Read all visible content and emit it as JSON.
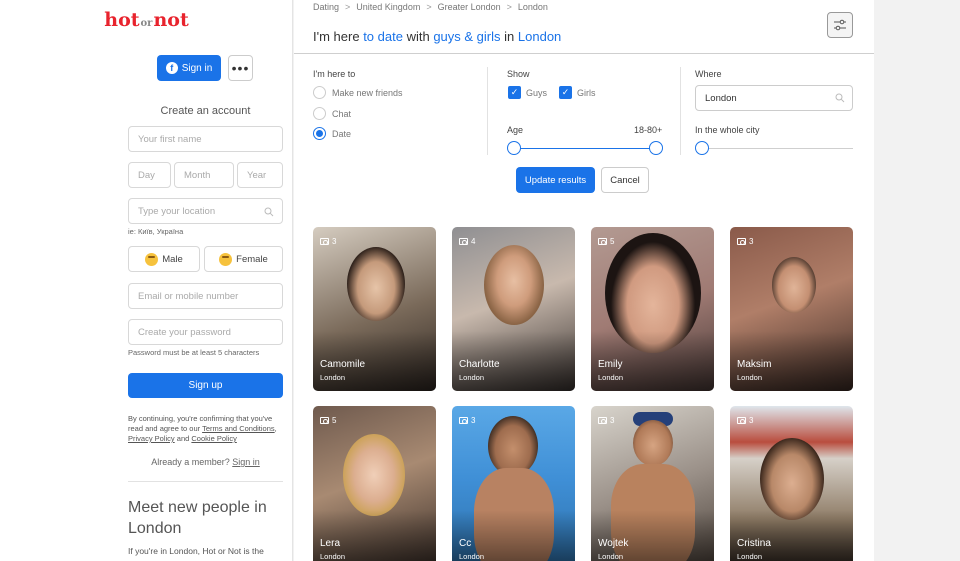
{
  "sidebar": {
    "logo": {
      "part1": "hot",
      "part2": "or",
      "part3": "not"
    },
    "signin_label": "Sign in",
    "create_title": "Create an account",
    "first_name_placeholder": "Your first name",
    "day_placeholder": "Day",
    "month_placeholder": "Month",
    "year_placeholder": "Year",
    "location_placeholder": "Type your location",
    "location_hint": "ie: Київ, Україна",
    "male_label": "Male",
    "female_label": "Female",
    "email_placeholder": "Email or mobile number",
    "password_placeholder": "Create your password",
    "password_hint": "Password must be at least 5 characters",
    "signup_label": "Sign up",
    "terms_prefix": "By continuing, you're confirming that you've read and agree to our",
    "terms_link": "Terms and Conditions",
    "privacy_link": "Privacy Policy",
    "and": "and",
    "cookie_link": "Cookie Policy",
    "member_prefix": "Already a member?",
    "member_link": "Sign in",
    "meet_title": "Meet new people in London",
    "meet_desc": "If you're in London, Hot or Not is the"
  },
  "breadcrumb": [
    "Dating",
    "United Kingdom",
    "Greater London",
    "London"
  ],
  "heading": {
    "p1": "I'm here",
    "p2": "to date",
    "p3": "with",
    "p4": "guys & girls",
    "p5": "in",
    "p6": "London"
  },
  "filters": {
    "here_label": "I'm here to",
    "options": [
      "Make new friends",
      "Chat",
      "Date"
    ],
    "selected": "Date",
    "show_label": "Show",
    "guys_label": "Guys",
    "girls_label": "Girls",
    "age_label": "Age",
    "age_range": "18-80+",
    "where_label": "Where",
    "where_value": "London",
    "city_label": "In the whole city",
    "update_label": "Update results",
    "cancel_label": "Cancel"
  },
  "profiles": [
    {
      "name": "Camomile",
      "city": "London",
      "photos": "3"
    },
    {
      "name": "Charlotte",
      "city": "London",
      "photos": "4"
    },
    {
      "name": "Emily",
      "city": "London",
      "photos": "5"
    },
    {
      "name": "Maksim",
      "city": "London",
      "photos": "3"
    },
    {
      "name": "Lera",
      "city": "London",
      "photos": "5"
    },
    {
      "name": "Cc",
      "city": "London",
      "photos": "3"
    },
    {
      "name": "Wojtek",
      "city": "London",
      "photos": "3"
    },
    {
      "name": "Cristina",
      "city": "London",
      "photos": "3"
    }
  ],
  "colors": {
    "accent": "#1a73e8",
    "brand": "#e8232d"
  }
}
